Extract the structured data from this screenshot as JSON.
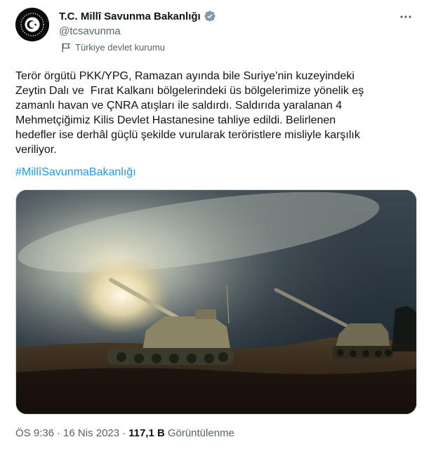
{
  "account": {
    "display_name": "T.C. Millî Savunma Bakanlığı",
    "handle": "@tcsavunma",
    "affiliation": "Türkiye devlet kurumu",
    "verified_color": "#829aab"
  },
  "tweet": {
    "text": "Terör örgütü PKK/YPG, Ramazan ayında bile Suriye’nin kuzeyindeki\nZeytin Dalı ve  Fırat Kalkanı bölgelerindeki üs bölgelerimize yönelik eş\nzamanlı havan ve ÇNRA atışları ile saldırdı. Saldırıda yaralanan 4\nMehmetçiğimiz Kilis Devlet Hastanesine tahliye edildi. Belirlenen\nhedefler ise derhâl güçlü şekilde vurularak teröristlere misliyle karşılık\nveriliyor.",
    "hashtag": "#MillîSavunmaBakanlığı",
    "hashtag_color": "#1d9bf0"
  },
  "meta": {
    "time": "ÖS 9:36",
    "date": "16 Nis 2023",
    "separator": "·",
    "views_count": "117,1 B",
    "views_label": "Görüntülenme"
  },
  "icons": {
    "more": "more-dots-icon",
    "verified": "verified-badge-icon",
    "flag": "government-flag-icon",
    "avatar": "ministry-emblem-logo"
  }
}
